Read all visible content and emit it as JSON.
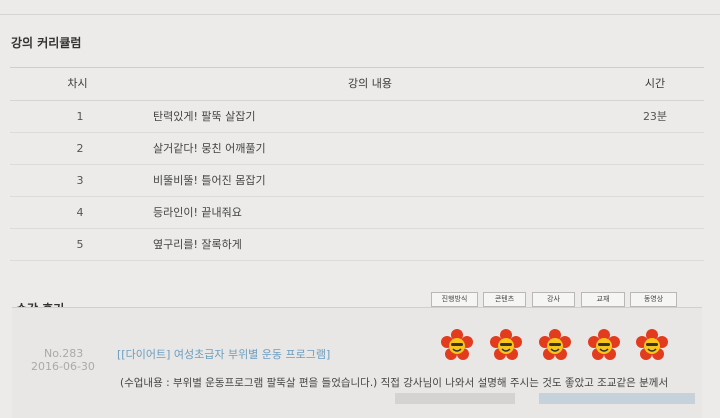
{
  "curriculum": {
    "title": "강의 커리큘럼",
    "headers": {
      "num": "차시",
      "content": "강의 내용",
      "time": "시간"
    },
    "rows": [
      {
        "num": "1",
        "title": "탄력있게! 팔뚝 살잡기",
        "time": "23분"
      },
      {
        "num": "2",
        "title": "살거같다! 뭉친 어깨풀기",
        "time": ""
      },
      {
        "num": "3",
        "title": "비뚤비뚤! 틀어진 몸잡기",
        "time": ""
      },
      {
        "num": "4",
        "title": "등라인이! 끝내줘요",
        "time": ""
      },
      {
        "num": "5",
        "title": "옆구리를! 잘록하게",
        "time": ""
      }
    ]
  },
  "reviews": {
    "title": "수강 후기",
    "tabs": [
      "진행방식",
      "콘텐츠",
      "강사",
      "교재",
      "동영상"
    ],
    "item": {
      "no": "No.283",
      "date": "2016-06-30",
      "title": "[[다이어트] 여성초급자 부위별 운동 프로그램]",
      "text": "(수업내용 : 부위별 운동프로그램 팔뚝살 편을 들었습니다.) 직접 강사님이 나와서 설명해 주시는 것도 좋았고 조교같은 분께서"
    },
    "rating_icons": [
      "flower-face-icon",
      "flower-face-icon",
      "flower-face-icon",
      "flower-face-icon",
      "flower-face-icon"
    ]
  }
}
